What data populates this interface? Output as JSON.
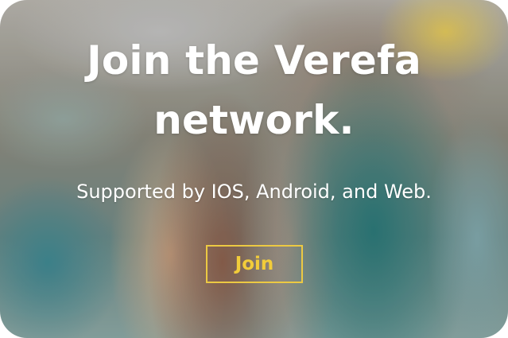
{
  "hero": {
    "headline_line1": "Join the Verefa",
    "headline_line2": "network.",
    "subtitle": "Supported by IOS, Android, and Web.",
    "join_label": "Join"
  },
  "colors": {
    "text": "#ffffff",
    "accent": "#ecc943"
  }
}
